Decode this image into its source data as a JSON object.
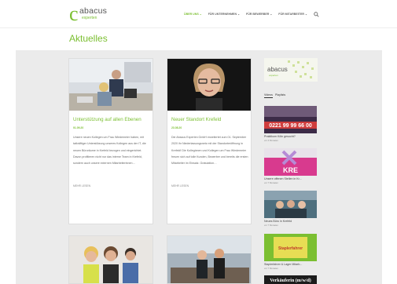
{
  "header": {
    "logo_main": "abacus",
    "logo_sub": "experten",
    "nav": [
      {
        "label": "ÜBER UNS",
        "active": true
      },
      {
        "label": "FÜR UNTERNEHMEN",
        "active": false
      },
      {
        "label": "FÜR BEWERBER",
        "active": false
      },
      {
        "label": "FÜR MITARBEITER",
        "active": false
      }
    ]
  },
  "page_title": "Aktuelles",
  "posts": [
    {
      "title": "Unterstützung auf allen Ebenen",
      "date": "01.09.20",
      "excerpt": "Unsere neuen Kollegen um Frau Wiedemeier haben, mit tatkräftiger Unterstützung unseres Kollegen aus der IT, die neuen Büroräume in Krefeld bezogen und eingerichtet. Davon profitieren nicht nur das interne Team in Krefeld, sondern auch unsere externen Mitarbeiterinnen…",
      "more": "MEHR LESEN"
    },
    {
      "title": "Neuer Standort Krefeld",
      "date": "23.08.20",
      "excerpt": "Die Abacus Experten GmbH erweitertet zum 01. September 2020 ihr Niederlassungsnetz mit der Standorteröffnung in Krefeld! Die Kolleginnen und Kollegen um Frau Wiedemeier freuen sich auf tolle Kunden, Bewerber und bereits die ersten Mitarbeiter im Einsatz. Gratulation…",
      "more": "MEHR LESEN"
    }
  ],
  "sidebar": {
    "tabs": [
      "Videos",
      "Playlists"
    ],
    "videos": [
      {
        "caption": "Praktikum Köln gesucht?",
        "sub": "vor 4 Monaten",
        "overlay": "0221 99 99 66 00"
      },
      {
        "caption": "Unsere offenen Stellen in Kr...",
        "sub": "vor 7 Monaten",
        "overlay": "KRE"
      },
      {
        "caption": "Neues Büro in Krefeld",
        "sub": "vor 7 Monaten",
        "overlay": ""
      },
      {
        "caption": "Staplerfahrer & Lager Mitarb...",
        "sub": "vor 7 Monaten",
        "overlay": "Staplerfahrer"
      },
      {
        "caption": "",
        "sub": "",
        "overlay": "Verkäuferin (m/w/d)"
      }
    ]
  },
  "colors": {
    "accent": "#7bbf31",
    "background_band": "#ebebeb"
  }
}
